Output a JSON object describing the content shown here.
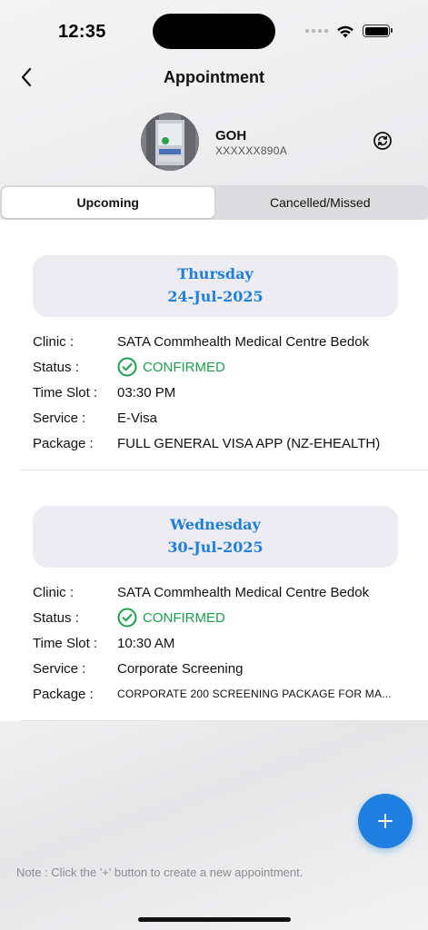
{
  "status_bar": {
    "time": "12:35"
  },
  "nav": {
    "title": "Appointment",
    "back_icon": "chevron-left-icon"
  },
  "profile": {
    "name": "GOH",
    "id": "XXXXXX890A",
    "refresh_icon": "refresh-icon"
  },
  "tabs": [
    {
      "label": "Upcoming",
      "active": true
    },
    {
      "label": "Cancelled/Missed",
      "active": false
    }
  ],
  "field_labels": {
    "clinic": "Clinic :",
    "status": "Status :",
    "time_slot": "Time Slot :",
    "service": "Service :",
    "package": "Package :"
  },
  "appointments": [
    {
      "day": "Thursday",
      "date": "24-Jul-2025",
      "clinic": "SATA Commhealth Medical Centre Bedok",
      "status": "CONFIRMED",
      "time_slot": "03:30 PM",
      "service": "E-Visa",
      "package": "FULL GENERAL VISA APP (NZ-EHEALTH)"
    },
    {
      "day": "Wednesday",
      "date": "30-Jul-2025",
      "clinic": "SATA Commhealth Medical Centre Bedok",
      "status": "CONFIRMED",
      "time_slot": "10:30 AM",
      "service": "Corporate Screening",
      "package": "CORPORATE 200 SCREENING PACKAGE FOR MA..."
    }
  ],
  "fab": {
    "icon": "plus-icon"
  },
  "note": "Note : Click the '+' button to create a new appointment.",
  "colors": {
    "accent": "#1e7fe0",
    "confirmed": "#1aa34a",
    "date_box": "#ececf2"
  }
}
